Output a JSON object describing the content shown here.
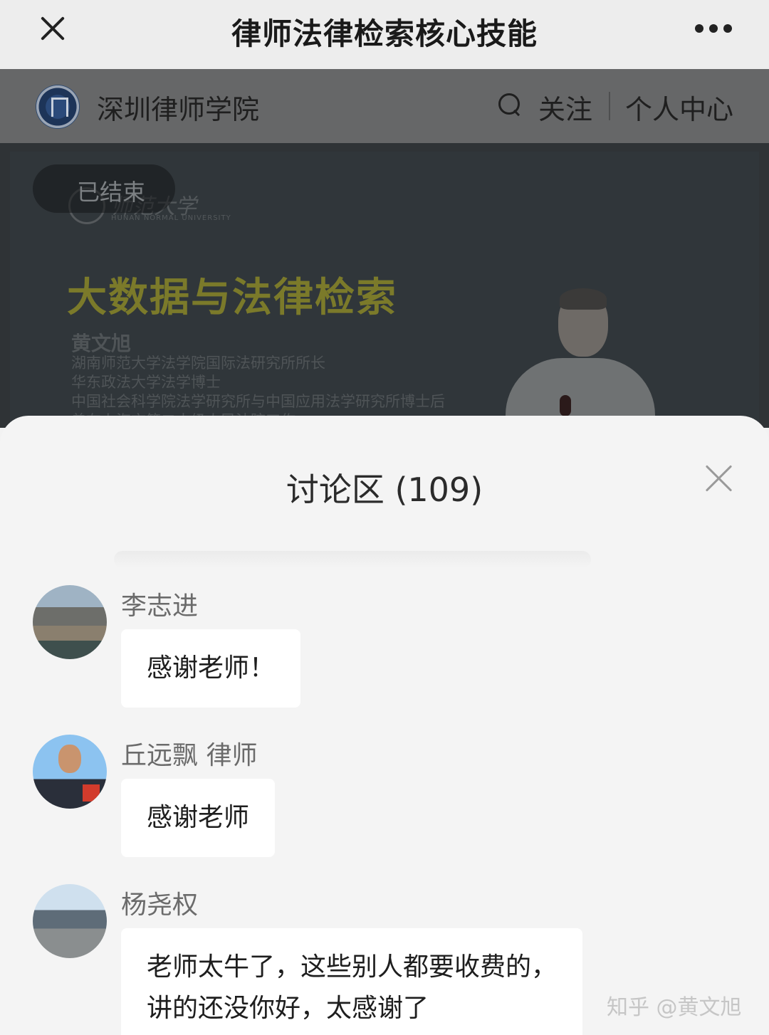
{
  "header": {
    "title": "律师法律检索核心技能"
  },
  "channel": {
    "name": "深圳律师学院",
    "follow_label": "关注",
    "profile_label": "个人中心"
  },
  "video": {
    "status_badge": "已结束",
    "university_name": "师范大学",
    "university_sub": "HUNAN NORMAL UNIVERSITY",
    "slide_title": "大数据与法律检索",
    "lecturer": "黄文旭",
    "credentials": [
      "湖南师范大学法学院国际法研究所所长",
      "华东政法大学法学博士",
      "中国社会科学院法学研究所与中国应用法学研究所博士后",
      "曾在上海市第二中级人民法院工作"
    ]
  },
  "discussion": {
    "title": "讨论区 (109)",
    "messages": [
      {
        "user": "李志进",
        "text": "感谢老师！"
      },
      {
        "user": "丘远飘 律师",
        "text": "感谢老师"
      },
      {
        "user": "杨尧权",
        "text": "老师太牛了，这些别人都要收费的，\n讲的还没你好，太感谢了"
      }
    ]
  },
  "watermark": "知乎 @黄文旭"
}
